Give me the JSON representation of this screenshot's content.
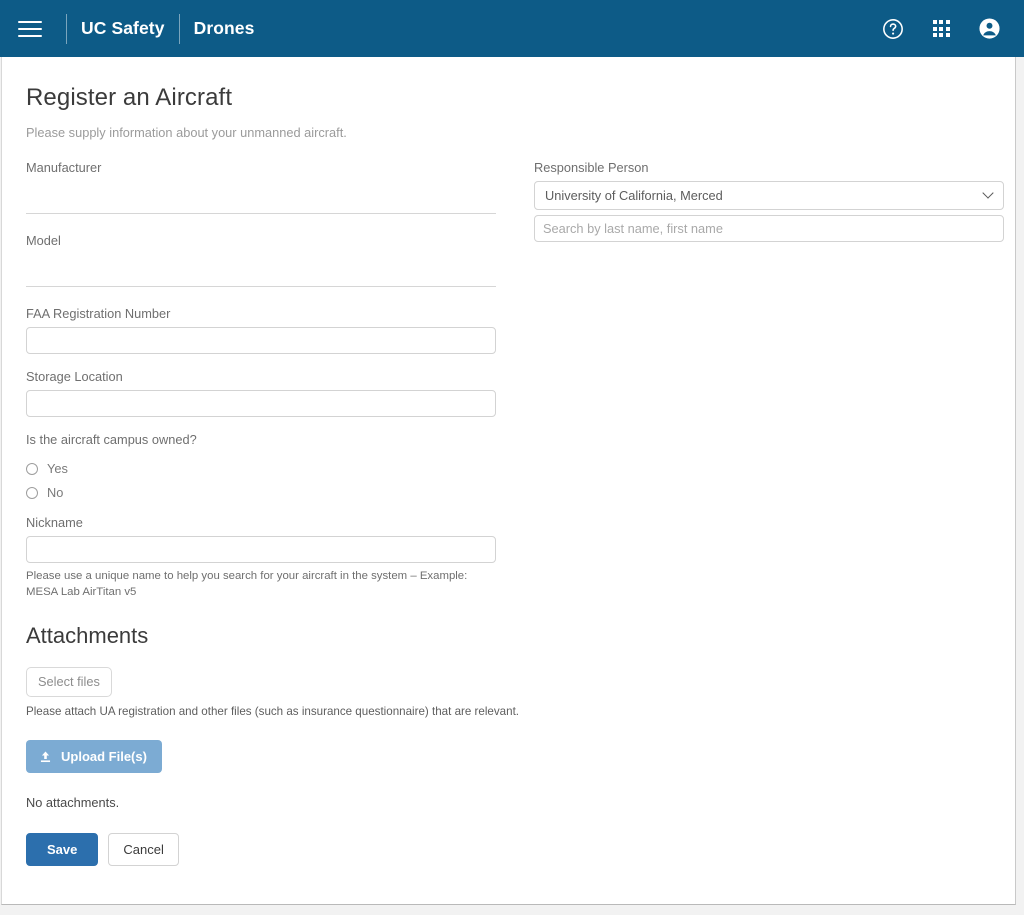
{
  "appbar": {
    "menu_icon": "hamburger-menu-icon",
    "brand_primary": "UC Safety",
    "brand_secondary": "Drones",
    "help_icon": "help-circle-icon",
    "apps_icon": "apps-grid-icon",
    "account_icon": "account-circle-icon",
    "background_color": "#0d5b87"
  },
  "page": {
    "title": "Register an Aircraft",
    "subtitle": "Please supply information about your unmanned aircraft."
  },
  "form": {
    "manufacturer": {
      "label": "Manufacturer",
      "value": "",
      "placeholder": ""
    },
    "model": {
      "label": "Model",
      "value": "",
      "placeholder": ""
    },
    "faa_registration": {
      "label": "FAA Registration Number",
      "value": "",
      "placeholder": ""
    },
    "storage_location": {
      "label": "Storage Location",
      "value": "",
      "placeholder": ""
    },
    "campus_owned": {
      "label": "Is the aircraft campus owned?",
      "options": [
        {
          "label": "Yes",
          "selected": false
        },
        {
          "label": "No",
          "selected": false
        }
      ]
    },
    "nickname": {
      "label": "Nickname",
      "value": "",
      "placeholder": "",
      "help": "Please use a unique name to help you search for your aircraft in the system – Example: MESA Lab AirTitan v5"
    },
    "responsible_person": {
      "label": "Responsible Person",
      "selected": "University of California, Merced",
      "options": [
        "University of California, Merced"
      ],
      "search_placeholder": "Search by last name, first name",
      "search_value": ""
    }
  },
  "attachments": {
    "title": "Attachments",
    "select_files_label": "Select files",
    "help": "Please attach UA registration and other files (such as insurance questionnaire) that are relevant.",
    "upload_label": "Upload File(s)",
    "upload_icon": "upload-arrow-icon",
    "upload_color": "#7cabd3",
    "empty_state": "No attachments."
  },
  "actions": {
    "save_label": "Save",
    "cancel_label": "Cancel",
    "save_color": "#2c6fad"
  }
}
